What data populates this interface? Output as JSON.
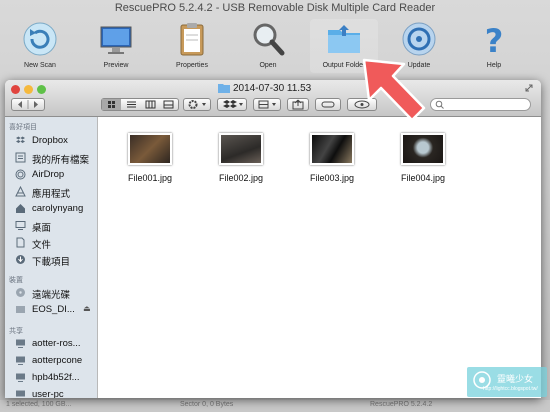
{
  "app": {
    "title": "RescuePRO 5.2.4.2 - USB Removable Disk Multiple Card  Reader",
    "toolbar": [
      {
        "label": "New Scan",
        "icon": "new-scan-icon"
      },
      {
        "label": "Preview",
        "icon": "monitor-icon"
      },
      {
        "label": "Properties",
        "icon": "clipboard-icon"
      },
      {
        "label": "Open",
        "icon": "magnifier-icon"
      },
      {
        "label": "Output Folder",
        "icon": "folder-icon"
      },
      {
        "label": "Update",
        "icon": "update-icon"
      },
      {
        "label": "Help",
        "icon": "help-icon"
      }
    ],
    "status": {
      "left": "1 selected, 100 GB...",
      "mid": "Sector 0, 0 Bytes",
      "right": "RescuePRO 5.2.4.2"
    }
  },
  "finder": {
    "title": "2014-07-30 11.53",
    "favorites_header": "喜好項目",
    "favorites": [
      {
        "label": "Dropbox",
        "icon": "dropbox-icon"
      },
      {
        "label": "我的所有檔案",
        "icon": "all-files-icon"
      },
      {
        "label": "AirDrop",
        "icon": "airdrop-icon"
      },
      {
        "label": "應用程式",
        "icon": "applications-icon"
      },
      {
        "label": "carolynyang",
        "icon": "home-icon"
      },
      {
        "label": "桌面",
        "icon": "desktop-icon"
      },
      {
        "label": "文件",
        "icon": "documents-icon"
      },
      {
        "label": "下載項目",
        "icon": "downloads-icon"
      }
    ],
    "devices_header": "裝置",
    "devices": [
      {
        "label": "遠端光碟",
        "icon": "disc-icon"
      },
      {
        "label": "EOS_DI...",
        "icon": "drive-icon",
        "eject": "⏏"
      }
    ],
    "shared_header": "共享",
    "shared": [
      {
        "label": "aotter-ros...",
        "icon": "computer-icon"
      },
      {
        "label": "aotterpcone",
        "icon": "computer-icon"
      },
      {
        "label": "hpb4b52f...",
        "icon": "computer-icon"
      },
      {
        "label": "user-pc",
        "icon": "computer-icon"
      }
    ],
    "files": [
      {
        "name": "File001.jpg"
      },
      {
        "name": "File002.jpg"
      },
      {
        "name": "File003.jpg"
      },
      {
        "name": "File004.jpg"
      }
    ]
  },
  "watermark": {
    "line1": "靈曦少女",
    "line2": "http://lightcc.blogspot.tw/"
  },
  "colors": {
    "accent": "#f05a5a",
    "sidebar": "#dde4eb",
    "close": "#e0443e",
    "minimize": "#f5b93d",
    "zoom": "#5fc148"
  }
}
